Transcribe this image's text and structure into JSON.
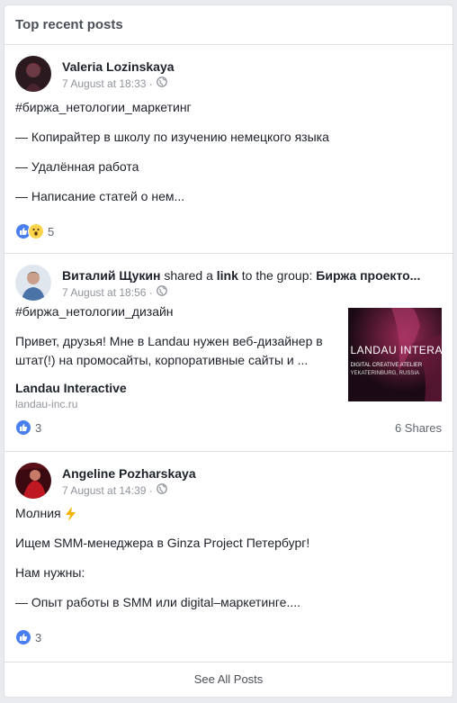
{
  "card": {
    "title": "Top recent posts",
    "see_all": "See All Posts"
  },
  "posts": [
    {
      "author": "Valeria Lozinskaya",
      "date": "7 August at 18:33 ·",
      "lines": [
        "#биржа_нетологии_маркетинг",
        "— Копирайтер в школу по изучению немецкого языка",
        "— Удалённая работа",
        "— Написание статей о нем..."
      ],
      "reaction_count": "5",
      "reactions": [
        "like-icon",
        "wow-icon"
      ]
    },
    {
      "author": "Виталий Щукин",
      "share_text": " shared a ",
      "share_link": "link",
      "share_text2": " to the group: ",
      "group": "Биржа проекто...",
      "date": "7 August at 18:56 ·",
      "hashtag": "#биржа_нетологии_дизайн",
      "text": "Привет, друзья! Мне в Landau нужен веб-дизайнер в штат(!) на промосайты, корпоративные сайты и ...",
      "link_title": "Landau Interactive",
      "link_domain": "landau-inc.ru",
      "thumb_title": "LANDAU INTERACT",
      "thumb_sub1": "DIGITAL CREATIVE ATELIER",
      "thumb_sub2": "YEKATERINBURG, RUSSIA",
      "reaction_count": "3",
      "shares": "6 Shares"
    },
    {
      "author": "Angeline Pozharskaya",
      "date": "7 August at 14:39 ·",
      "first_line": "Молния",
      "lines": [
        "Ищем SMM-менеджера в Ginza Project Петербург!",
        "Нам нужны:",
        "— Опыт работы в SMM или digital–маркетинге...."
      ],
      "reaction_count": "3"
    }
  ],
  "colors": {
    "link_blue": "#385898",
    "like_blue": "#4a7ff0",
    "secondary": "#90949c"
  }
}
